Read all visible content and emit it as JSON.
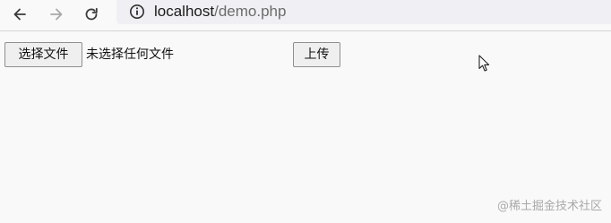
{
  "browser": {
    "url_host": "localhost",
    "url_path": "/demo.php",
    "icons": {
      "back": "arrow-left-icon",
      "forward": "arrow-right-icon",
      "reload": "reload-icon",
      "site_info": "info-circle-icon"
    }
  },
  "form": {
    "choose_file_label": "选择文件",
    "no_file_text": "未选择任何文件",
    "upload_label": "上传"
  },
  "watermark": "@稀土掘金技术社区"
}
